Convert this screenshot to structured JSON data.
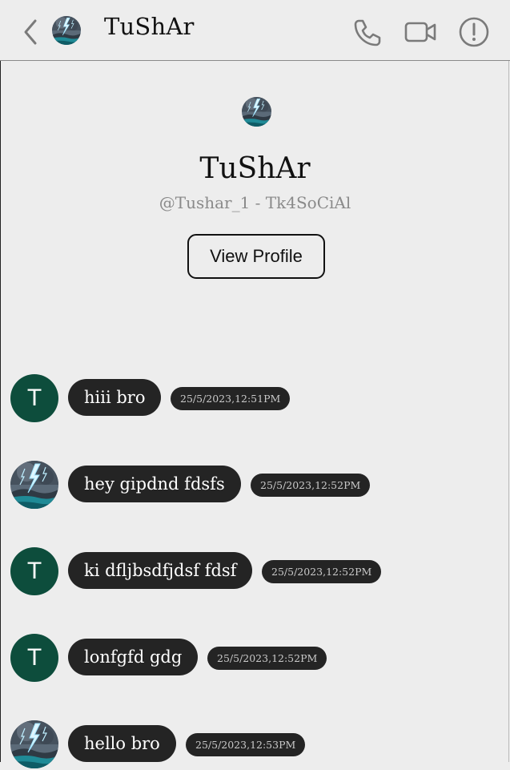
{
  "header": {
    "title": "TuShAr",
    "back_icon": "chevron-left-icon",
    "call_icon": "phone-icon",
    "video_icon": "video-camera-icon",
    "info_icon": "alert-circle-icon"
  },
  "intro": {
    "name": "TuShAr",
    "handle": "@Tushar_1 - Tk4SoCiAl",
    "view_profile_label": "View Profile"
  },
  "messages": [
    {
      "avatar_letter": "T",
      "text": "hiii bro",
      "time": "25/5/2023,12:51PM"
    },
    {
      "avatar_letter": "",
      "text": "hey gipdnd fdsfs",
      "time": "25/5/2023,12:52PM"
    },
    {
      "avatar_letter": "T",
      "text": "ki dfljbsdfjdsf fdsf",
      "time": "25/5/2023,12:52PM"
    },
    {
      "avatar_letter": "T",
      "text": "lonfgfd gdg",
      "time": "25/5/2023,12:52PM"
    },
    {
      "avatar_letter": "",
      "text": "hello bro",
      "time": "25/5/2023,12:53PM"
    }
  ],
  "colors": {
    "background": "#ededed",
    "bubble": "#242424",
    "letter_avatar": "#0d4d3c",
    "icon": "#7a7a7a"
  }
}
